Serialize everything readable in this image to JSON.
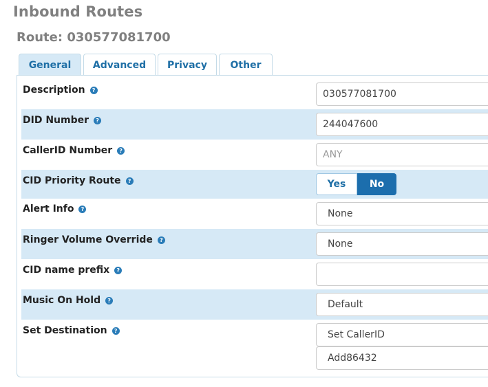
{
  "page": {
    "title": "Inbound Routes",
    "route_title": "Route: 030577081700"
  },
  "tabs": [
    {
      "label": "General",
      "active": true
    },
    {
      "label": "Advanced",
      "active": false
    },
    {
      "label": "Privacy",
      "active": false
    },
    {
      "label": "Other",
      "active": false
    }
  ],
  "form": {
    "description": {
      "label": "Description",
      "value": "030577081700"
    },
    "did_number": {
      "label": "DID Number",
      "value": "244047600"
    },
    "callerid_number": {
      "label": "CallerID Number",
      "placeholder": "ANY"
    },
    "cid_priority_route": {
      "label": "CID Priority Route",
      "yes": "Yes",
      "no": "No",
      "selected": "No"
    },
    "alert_info": {
      "label": "Alert Info",
      "value": "None"
    },
    "ringer_volume_override": {
      "label": "Ringer Volume Override",
      "value": "None"
    },
    "cid_name_prefix": {
      "label": "CID name prefix",
      "value": ""
    },
    "music_on_hold": {
      "label": "Music On Hold",
      "value": "Default"
    },
    "set_destination": {
      "label": "Set Destination",
      "type_value": "Set CallerID",
      "target_value": "Add86432"
    }
  },
  "help_icon": {
    "glyph": "?",
    "name": "help-icon"
  },
  "colors": {
    "accent": "#1c6ead",
    "row_shade": "#d6e9f6",
    "title_gray": "#808080"
  }
}
